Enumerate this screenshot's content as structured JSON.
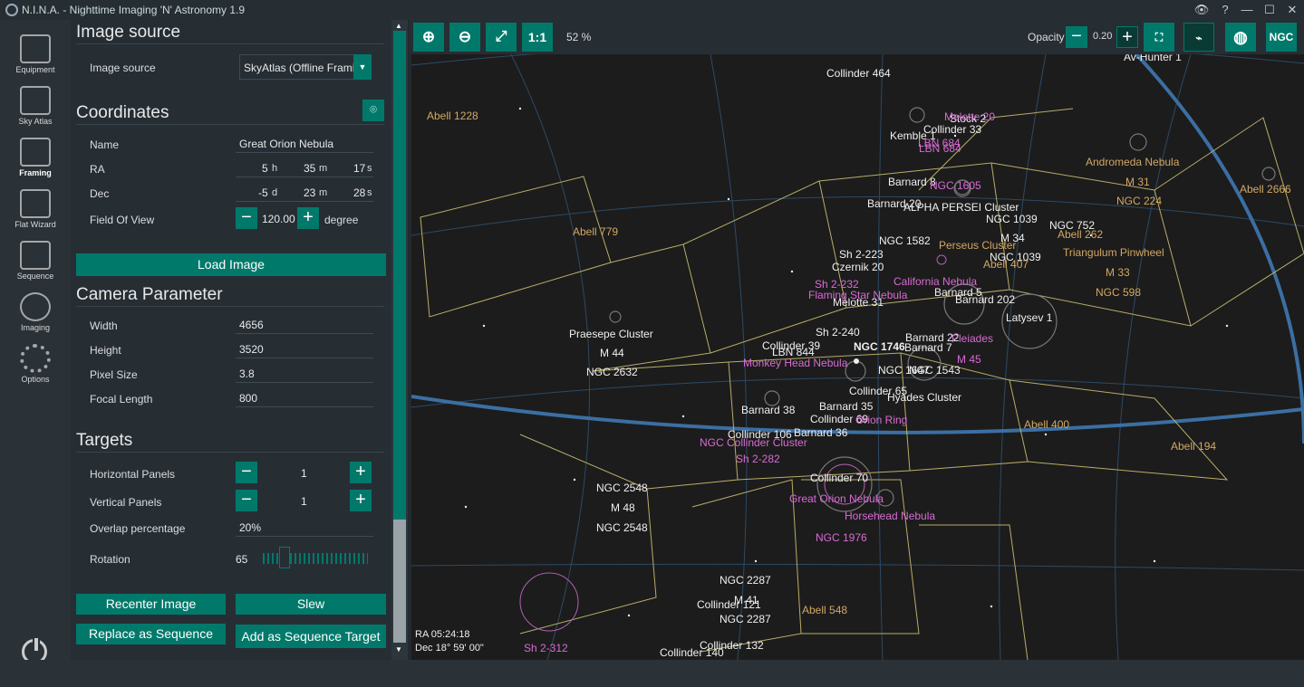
{
  "window": {
    "title": "N.I.N.A. - Nighttime Imaging 'N' Astronomy 1.9",
    "controls": [
      "👁",
      "?",
      "—",
      "☐",
      "✕"
    ]
  },
  "sidebar": {
    "items": [
      {
        "label": "Equipment",
        "icon": "telescope-icon"
      },
      {
        "label": "Sky Atlas",
        "icon": "map-icon"
      },
      {
        "label": "Framing",
        "icon": "framing-icon"
      },
      {
        "label": "Flat Wizard",
        "icon": "flat-wizard-icon"
      },
      {
        "label": "Sequence",
        "icon": "sequence-icon"
      },
      {
        "label": "Imaging",
        "icon": "imaging-icon"
      },
      {
        "label": "Options",
        "icon": "gear-icon"
      }
    ],
    "active": "Framing"
  },
  "image_source": {
    "heading": "Image source",
    "label": "Image source",
    "value": "SkyAtlas (Offline Framing)"
  },
  "coordinates": {
    "heading": "Coordinates",
    "name_label": "Name",
    "name": "Great Orion Nebula",
    "ra_label": "RA",
    "ra_h": "5",
    "ra_m": "35",
    "ra_s": "17",
    "dec_label": "Dec",
    "dec_d": "-5",
    "dec_m": "23",
    "dec_s": "28",
    "unit_h": "h",
    "unit_m": "m",
    "unit_s": "s",
    "unit_d": "d",
    "fov_label": "Field Of View",
    "fov": "120.00",
    "fov_unit": "degree",
    "load_button": "Load Image"
  },
  "camera": {
    "heading": "Camera Parameter",
    "width_label": "Width",
    "width": "4656",
    "height_label": "Height",
    "height": "3520",
    "pixel_label": "Pixel Size",
    "pixel": "3.8",
    "focal_label": "Focal Length",
    "focal": "800"
  },
  "targets": {
    "heading": "Targets",
    "hpanels_label": "Horizontal Panels",
    "hpanels": "1",
    "vpanels_label": "Vertical Panels",
    "vpanels": "1",
    "overlap_label": "Overlap percentage",
    "overlap": "20%",
    "rotation_label": "Rotation",
    "rotation": "65"
  },
  "actions": {
    "recenter": "Recenter Image",
    "slew": "Slew",
    "replace": "Replace as Sequence",
    "add": "Add as Sequence Target"
  },
  "map_toolbar": {
    "zoom_in": "zoom-in-icon",
    "zoom_out": "zoom-out-icon",
    "fit": "fit-icon",
    "one_to_one": "1:1",
    "zoom": "52 %",
    "opacity_label": "Opacity",
    "opacity": "0.20",
    "ngc": "NGC"
  },
  "skymap": {
    "ra_readout": "RA  05:24:18",
    "dec_readout": "Dec  18° 59' 00\"",
    "labels_white": [
      "Collinder 464",
      "Av-Hunter 1",
      "Collinder 33",
      "Kemble 1",
      "Stock 2",
      "Barnard 8",
      "Barnard 20",
      "ALPHA PERSEI Cluster",
      "NGC 1039",
      "NGC 752",
      "NGC 1582",
      "M 34",
      "Sh 2-223",
      "Czernik 20",
      "NGC 1039",
      "Barnard 5",
      "Barnard 202",
      "Melotte 31",
      "Latysev 1",
      "Praesepe Cluster",
      "M 44",
      "NGC 2632",
      "Sh 2-240",
      "Collinder 39",
      "LBN 844",
      "NGC 1746",
      "Barnard 22",
      "Barnard 7",
      "NGC 1647",
      "NGC 1543",
      "Collinder 65",
      "Barnard 38",
      "Barnard 35",
      "Collinder 69",
      "Hyades Cluster",
      "Barnard 36",
      "Collinder 106",
      "NGC 2548",
      "M 48",
      "NGC 2548",
      "Collinder 70",
      "NGC 2287",
      "M 41",
      "Collinder 121",
      "NGC 2287",
      "Collinder 132",
      "Collinder 140"
    ],
    "labels_orange": [
      "Abell 1228",
      "Andromeda Nebula",
      "M 31",
      "NGC 224",
      "Abell 2666",
      "Abell 779",
      "Abell 262",
      "Perseus Cluster",
      "Abell 407",
      "Triangulum Pinwheel",
      "M 33",
      "NGC 598",
      "Abell 400",
      "Abell 194",
      "Abell 548"
    ],
    "labels_pink": [
      "Melotte 20",
      "LBN 684",
      "LBN 684",
      "NGC 1605",
      "California Nebula",
      "Sh 2-232",
      "Flaming Star Nebula",
      "Pleiades",
      "M 45",
      "Monkey Head Nebula",
      "Orion Ring",
      "NGC Collinder Cluster",
      "Sh 2-282",
      "Great Orion Nebula",
      "Horsehead Nebula",
      "NGC 1976",
      "Sh 2-312"
    ]
  }
}
